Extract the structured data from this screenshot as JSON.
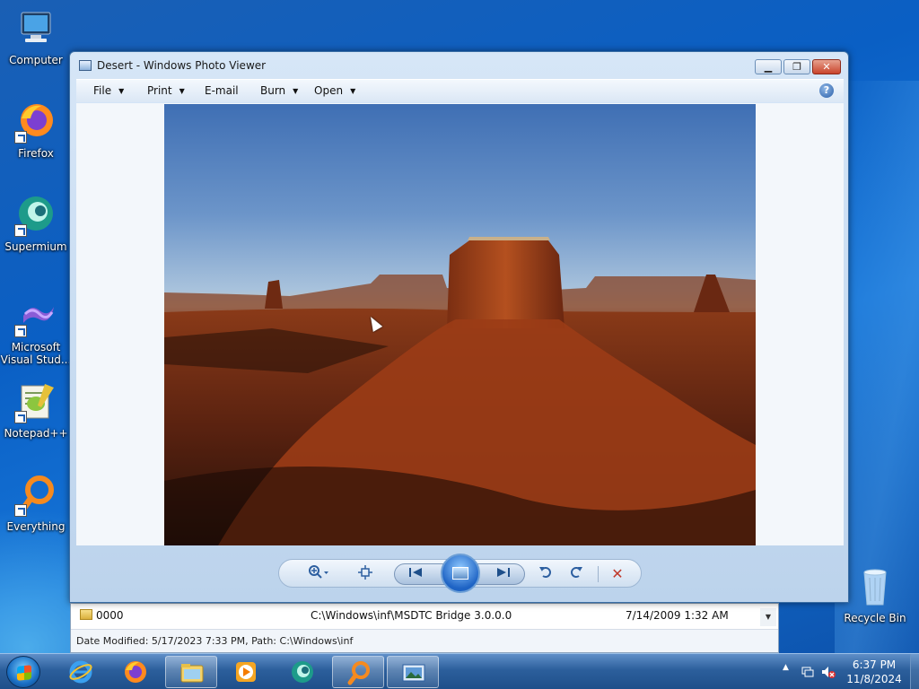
{
  "desktop": {
    "icons": [
      {
        "label": "Computer",
        "icon": "computer-icon"
      },
      {
        "label": "Firefox",
        "icon": "firefox-icon"
      },
      {
        "label": "Supermium",
        "icon": "supermium-icon"
      },
      {
        "label": "Microsoft Visual Stud...",
        "icon": "visual-studio-icon"
      },
      {
        "label": "Notepad++",
        "icon": "notepadpp-icon"
      },
      {
        "label": "Everything",
        "icon": "everything-icon"
      },
      {
        "label": "Recycle Bin",
        "icon": "recycle-bin-icon"
      }
    ]
  },
  "photo_viewer": {
    "title": "Desert - Windows Photo Viewer",
    "menu": {
      "file": "File",
      "print": "Print",
      "email": "E-mail",
      "burn": "Burn",
      "open": "Open",
      "help": "?"
    },
    "controls": {
      "zoom": "zoom-icon",
      "actual_size": "actual-size-icon",
      "previous": "previous-icon",
      "slideshow": "slideshow-icon",
      "next": "next-icon",
      "rotate_ccw": "rotate-counterclockwise-icon",
      "rotate_cw": "rotate-clockwise-icon",
      "delete": "delete-icon"
    }
  },
  "explorer": {
    "row": {
      "name": "0000",
      "path": "C:\\Windows\\inf\\MSDTC Bridge 3.0.0.0",
      "date": "7/14/2009 1:32 AM"
    },
    "status": "Date Modified: 5/17/2023 7:33 PM, Path: C:\\Windows\\inf"
  },
  "taskbar": {
    "apps": [
      {
        "name": "internet-explorer-icon"
      },
      {
        "name": "firefox-icon"
      },
      {
        "name": "file-explorer-icon"
      },
      {
        "name": "media-player-icon"
      },
      {
        "name": "supermium-icon"
      },
      {
        "name": "everything-icon"
      },
      {
        "name": "photo-viewer-icon"
      }
    ],
    "time": "6:37 PM",
    "date": "11/8/2024"
  },
  "colors": {
    "desktop_blue": "#0a5fc4",
    "window_frame": "#bcd3ec",
    "close_red": "#c9442b",
    "delete_red": "#c0392b"
  }
}
